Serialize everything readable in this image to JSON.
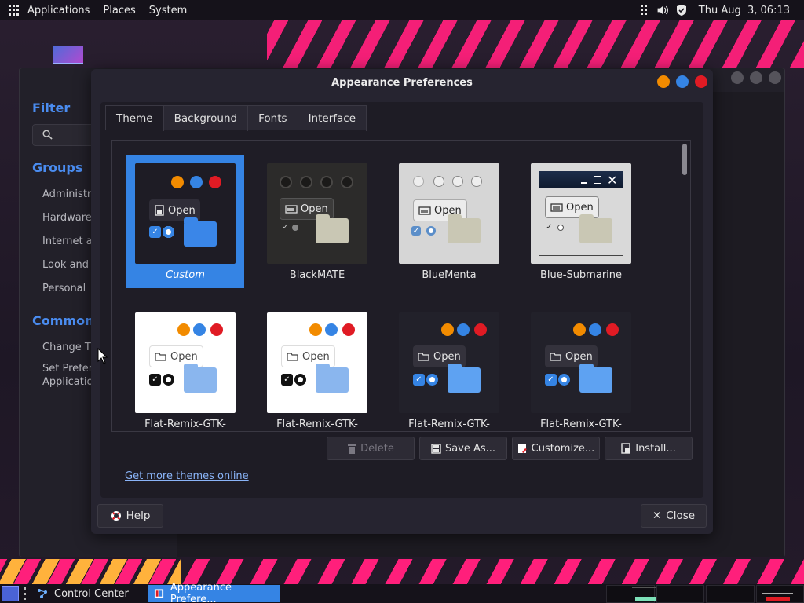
{
  "top_panel": {
    "menus": [
      "Applications",
      "Places",
      "System"
    ],
    "clock": "Thu Aug  3, 06:13"
  },
  "control_center": {
    "filter_heading": "Filter",
    "groups_heading": "Groups",
    "groups": [
      "Administra",
      "Hardware",
      "Internet ar",
      "Look and F",
      "Personal"
    ],
    "common_heading": "Common T",
    "common": [
      "Change Th",
      "Set Prefer",
      "Applicatio"
    ]
  },
  "dialog": {
    "title": "Appearance Preferences",
    "tabs": [
      "Theme",
      "Background",
      "Fonts",
      "Interface"
    ],
    "themes": [
      {
        "name": "Custom"
      },
      {
        "name": "BlackMATE"
      },
      {
        "name": "BlueMenta"
      },
      {
        "name": "Blue-Submarine"
      },
      {
        "name": "Flat-Remix-GTK-"
      },
      {
        "name": "Flat-Remix-GTK-"
      },
      {
        "name": "Flat-Remix-GTK-"
      },
      {
        "name": "Flat-Remix-GTK-"
      }
    ],
    "open_label": "Open",
    "buttons": {
      "delete": "Delete",
      "save_as": "Save As...",
      "customize": "Customize...",
      "install": "Install..."
    },
    "more_link": "Get more themes online",
    "help": "Help",
    "close": "Close"
  },
  "taskbar": {
    "tasks": [
      "Control Center",
      "Appearance Prefere..."
    ]
  },
  "colors": {
    "accent": "#3584e4",
    "close_red": "#e01b24",
    "minimize_orange": "#f28b00",
    "maximize_blue": "#3584e4",
    "link": "#8ab4f8",
    "heading_blue": "#4a8cf0"
  }
}
